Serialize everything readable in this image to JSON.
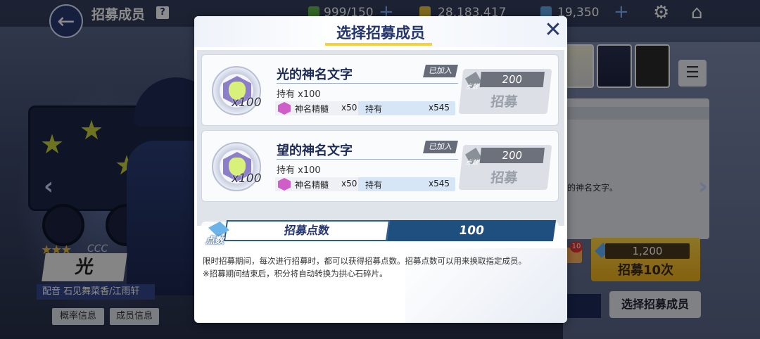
{
  "header": {
    "title": "招募成员",
    "help_icon": "?",
    "stamina": "999/150",
    "coins": "28,183,417",
    "gems": "19,350"
  },
  "character": {
    "rarity": "CCC",
    "name": "光",
    "cv": "配音 石见舞菜香/江雨轩",
    "buttons": {
      "prob": "概率信息",
      "member": "成员信息"
    }
  },
  "background": {
    "desc_fragment": "的神名文字。",
    "gacha10": {
      "cost": "1,200",
      "label": "招募10次",
      "badge": "10"
    },
    "select_member": "选择招募成员"
  },
  "modal": {
    "title": "选择招募成员",
    "close": "✕",
    "items": [
      {
        "name": "光的神名文字",
        "status": "已加入",
        "count": "x100",
        "own": "持有 x100",
        "essence_label": "神名精髓",
        "essence_qty": "x50",
        "have_label": "持有",
        "have_qty": "x545",
        "cost": "200",
        "cost_icon_label": "点数",
        "button": "招募"
      },
      {
        "name": "望的神名文字",
        "status": "已加入",
        "count": "x100",
        "own": "持有 x100",
        "essence_label": "神名精髓",
        "essence_qty": "x50",
        "have_label": "持有",
        "have_qty": "x545",
        "cost": "200",
        "cost_icon_label": "点数",
        "button": "招募"
      }
    ],
    "points": {
      "icon_label": "点数",
      "label": "招募点数",
      "value": "100"
    },
    "notes": [
      "限时招募期间，每次进行招募时，都可以获得招募点数。招募点数可以用来换取指定成员。",
      "※招募期间结束后，积分将自动转换为拱心石碎片。"
    ]
  },
  "colors": {
    "title": "#23356c",
    "underline": "#f3d13b",
    "points_value_bg": "#1f4f7e",
    "disabled_btn": "#dcdfe5"
  }
}
